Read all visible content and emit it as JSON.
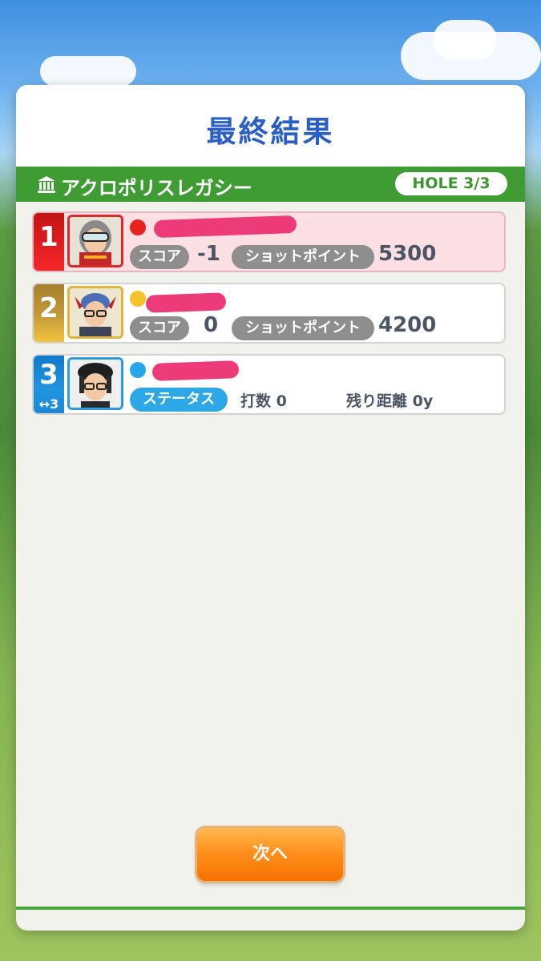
{
  "header": {
    "title": "最終結果"
  },
  "course": {
    "name": "アクロポリスレガシー",
    "hole": "HOLE 3/3",
    "icon": "temple-icon"
  },
  "players": [
    {
      "rank": "1",
      "rank_color": "#d91a1a",
      "dot_color": "#e8231f",
      "border_color": "#d72b2b",
      "score_label": "スコア",
      "score": "-1",
      "points_label": "ショットポイント",
      "points": "5300"
    },
    {
      "rank": "2",
      "rank_color": "#b8892a",
      "dot_color": "#f4c22b",
      "border_color": "#e3b43c",
      "score_label": "スコア",
      "score": "0",
      "points_label": "ショットポイント",
      "points": "4200"
    },
    {
      "rank": "3",
      "rank_sub": "↔3",
      "rank_color": "#1b8fd9",
      "dot_color": "#27a6e8",
      "border_color": "#2a9be0",
      "status_label": "ステータス",
      "strokes": "打数 0",
      "remaining": "残り距離 0y"
    }
  ],
  "footer": {
    "next_label": "次へ"
  },
  "colors": {
    "accent_green": "#3f9c33",
    "title_blue": "#2a5fc8",
    "button_orange": "#ff8d1a"
  }
}
